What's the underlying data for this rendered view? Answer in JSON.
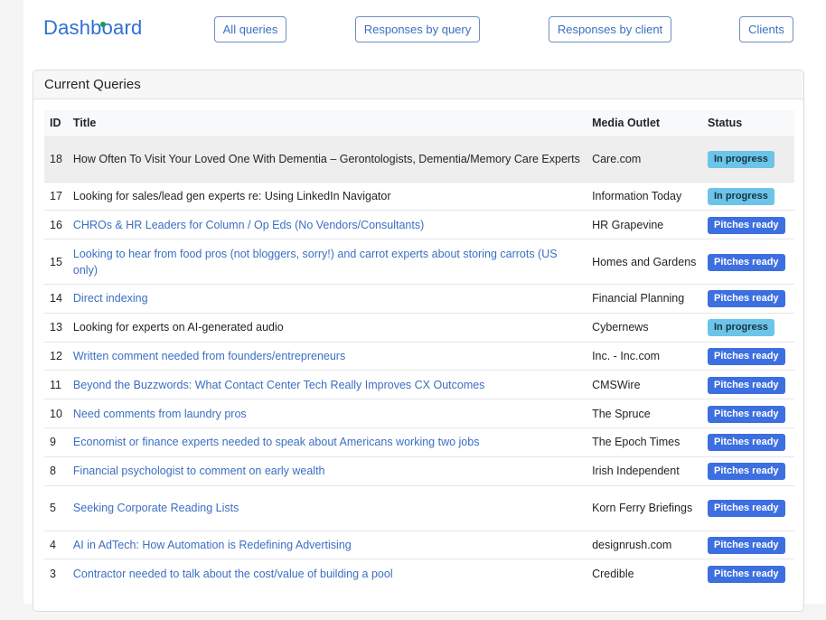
{
  "header": {
    "brand": "Dashboard",
    "nav": [
      {
        "label": "All queries"
      },
      {
        "label": "Responses by query"
      },
      {
        "label": "Responses by client"
      },
      {
        "label": "Clients"
      }
    ]
  },
  "card": {
    "title": "Current Queries",
    "columns": [
      "ID",
      "Title",
      "Media Outlet",
      "Status"
    ],
    "rows": [
      {
        "id": "18",
        "title": "How Often To Visit Your Loved One With Dementia – Gerontologists, Dementia/Memory Care Experts",
        "outlet": "Care.com",
        "status": "In progress"
      },
      {
        "id": "17",
        "title": "Looking for sales/lead gen experts re: Using LinkedIn Navigator",
        "outlet": "Information Today",
        "status": "In progress"
      },
      {
        "id": "16",
        "title": "CHROs & HR Leaders for Column / Op Eds (No Vendors/Consultants)",
        "outlet": "HR Grapevine",
        "status": "Pitches ready"
      },
      {
        "id": "15",
        "title": "Looking to hear from food pros (not bloggers, sorry!) and carrot experts about storing carrots (US only)",
        "outlet": "Homes and Gardens",
        "status": "Pitches ready"
      },
      {
        "id": "14",
        "title": "Direct indexing",
        "outlet": "Financial Planning",
        "status": "Pitches ready"
      },
      {
        "id": "13",
        "title": "Looking for experts on AI-generated audio",
        "outlet": "Cybernews",
        "status": "In progress"
      },
      {
        "id": "12",
        "title": "Written comment needed from founders/entrepreneurs",
        "outlet": "Inc. - Inc.com",
        "status": "Pitches ready"
      },
      {
        "id": "11",
        "title": "Beyond the Buzzwords: What Contact Center Tech Really Improves CX Outcomes",
        "outlet": "CMSWire",
        "status": "Pitches ready"
      },
      {
        "id": "10",
        "title": "Need comments from laundry pros",
        "outlet": "The Spruce",
        "status": "Pitches ready"
      },
      {
        "id": "9",
        "title": "Economist or finance experts needed to speak about Americans working two jobs",
        "outlet": "The Epoch Times",
        "status": "Pitches ready"
      },
      {
        "id": "8",
        "title": "Financial psychologist to comment on early wealth",
        "outlet": "Irish Independent",
        "status": "Pitches ready"
      },
      {
        "id": "5",
        "title": "Seeking Corporate Reading Lists",
        "outlet": "Korn Ferry Briefings",
        "status": "Pitches ready"
      },
      {
        "id": "4",
        "title": "AI in AdTech: How Automation is Redefining Advertising",
        "outlet": "designrush.com",
        "status": "Pitches ready"
      },
      {
        "id": "3",
        "title": "Contractor needed to talk about the cost/value of building a pool",
        "outlet": "Credible",
        "status": "Pitches ready"
      }
    ]
  },
  "colors": {
    "brand": "#2f6fd1",
    "link": "#3b6fc2",
    "badge_ready": "#3d6fe0",
    "badge_progress": "#6cc4e8"
  }
}
